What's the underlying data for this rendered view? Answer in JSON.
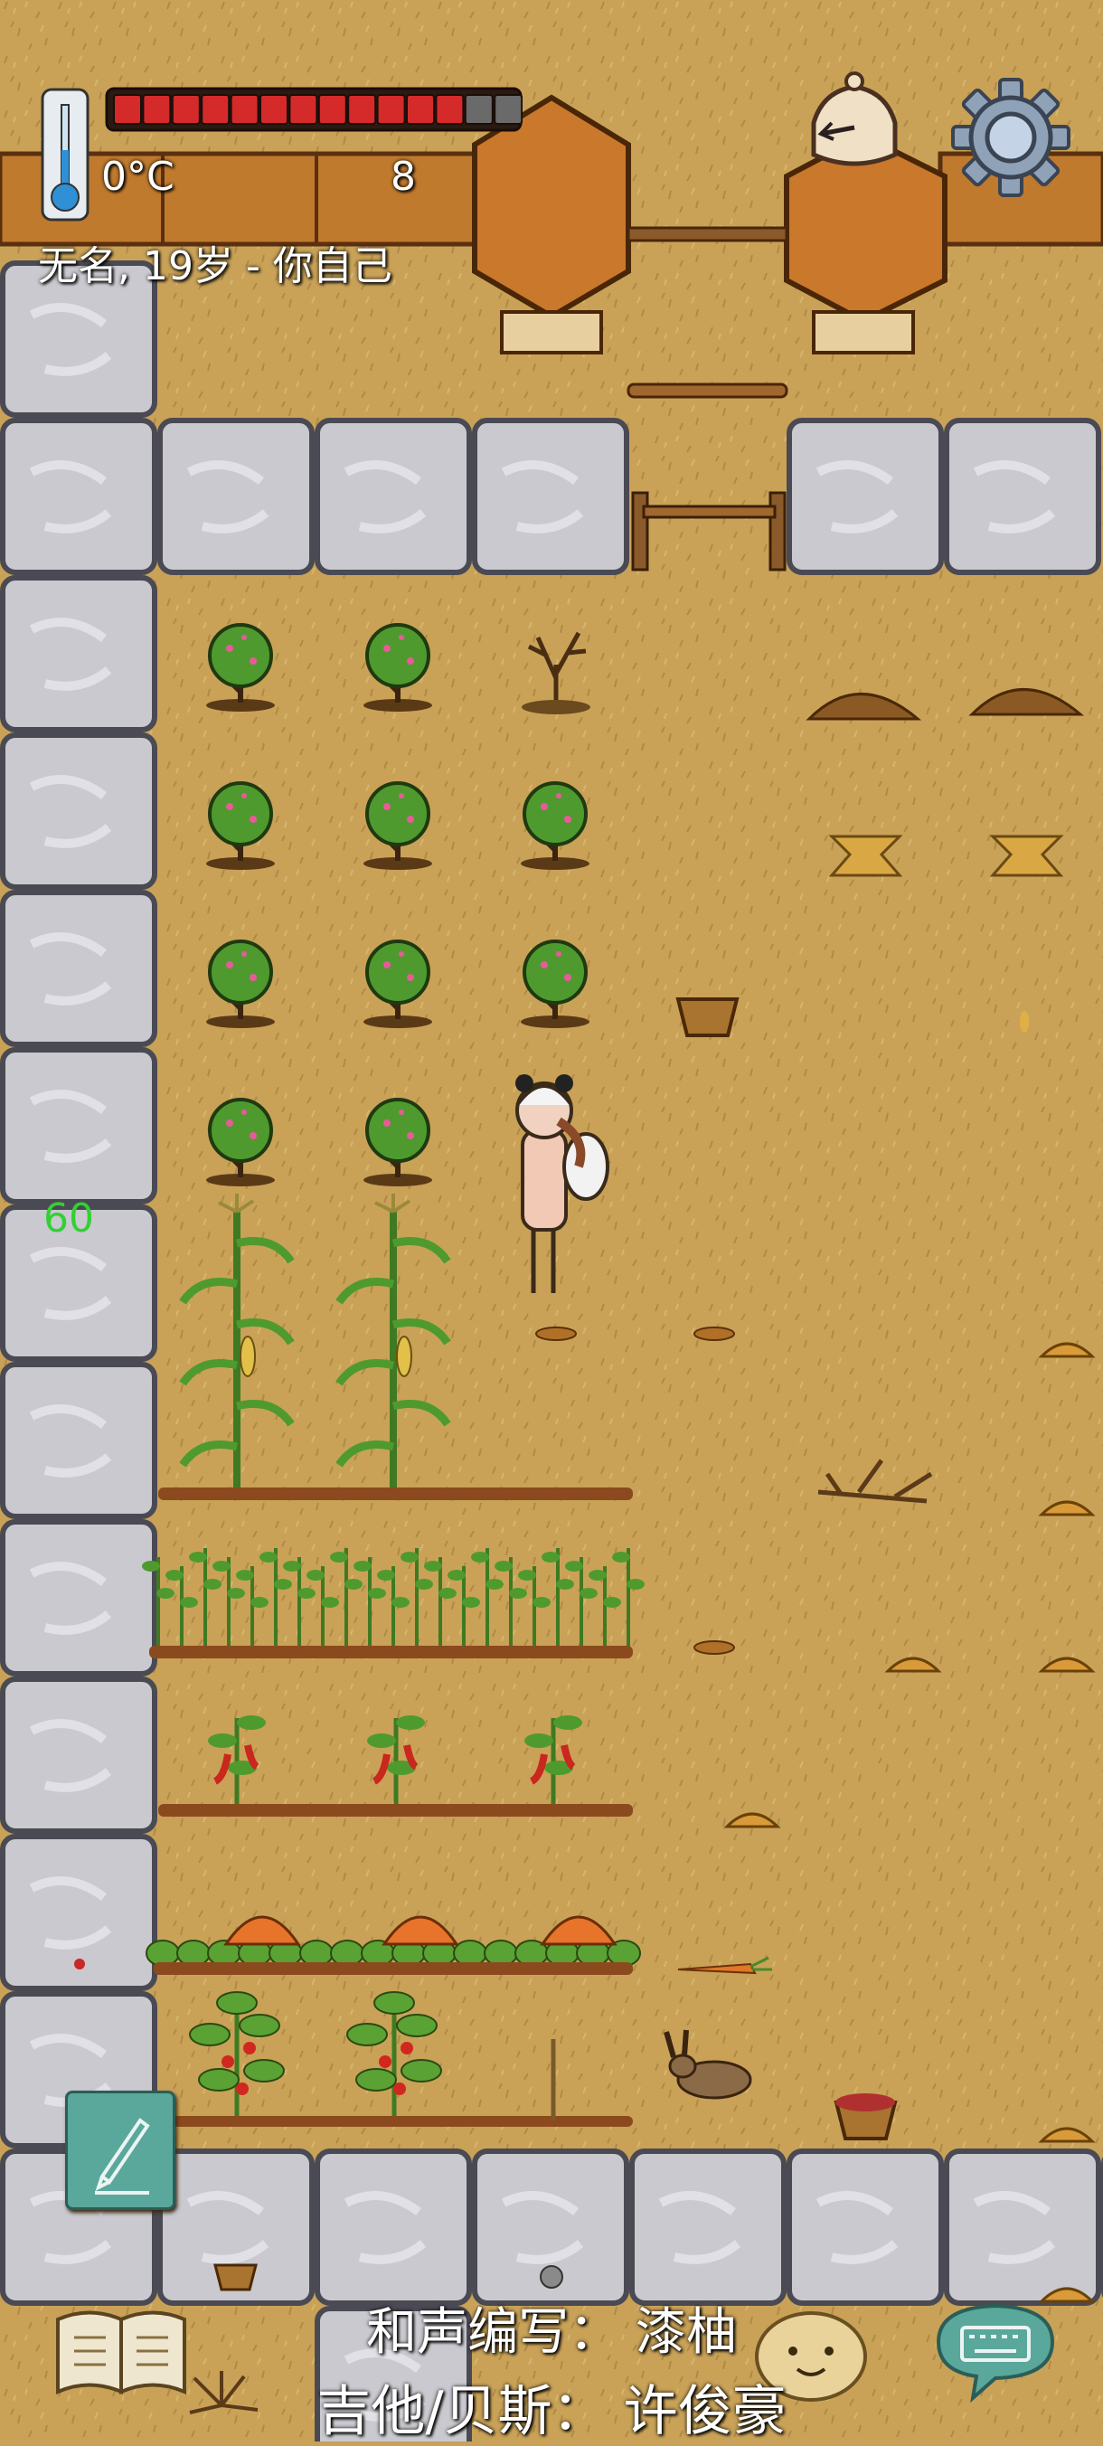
{
  "hud": {
    "temperature": "0°C",
    "food_count": "8",
    "food_meter": {
      "filled": 12,
      "total": 14
    },
    "player": "无名, 19岁 - 你自己",
    "age_float": "60"
  },
  "credits": {
    "line1": "和声编写：  漆柚",
    "line2": "吉他/贝斯：  许俊豪"
  },
  "icons": {
    "thermometer": "thermometer-icon",
    "clock": "clock-icon",
    "settings": "gear-icon",
    "pencil": "pencil-icon",
    "book": "recipe-book-icon",
    "face": "emote-face-icon",
    "keyboard": "keyboard-icon"
  },
  "colors": {
    "ground": "#c9a258",
    "stone": "#c9c9cf",
    "food_bar": "#d42a2a",
    "age_text": "#33d033",
    "pencil_button": "#5aa79c",
    "keyboard_button": "#5aa79c"
  }
}
